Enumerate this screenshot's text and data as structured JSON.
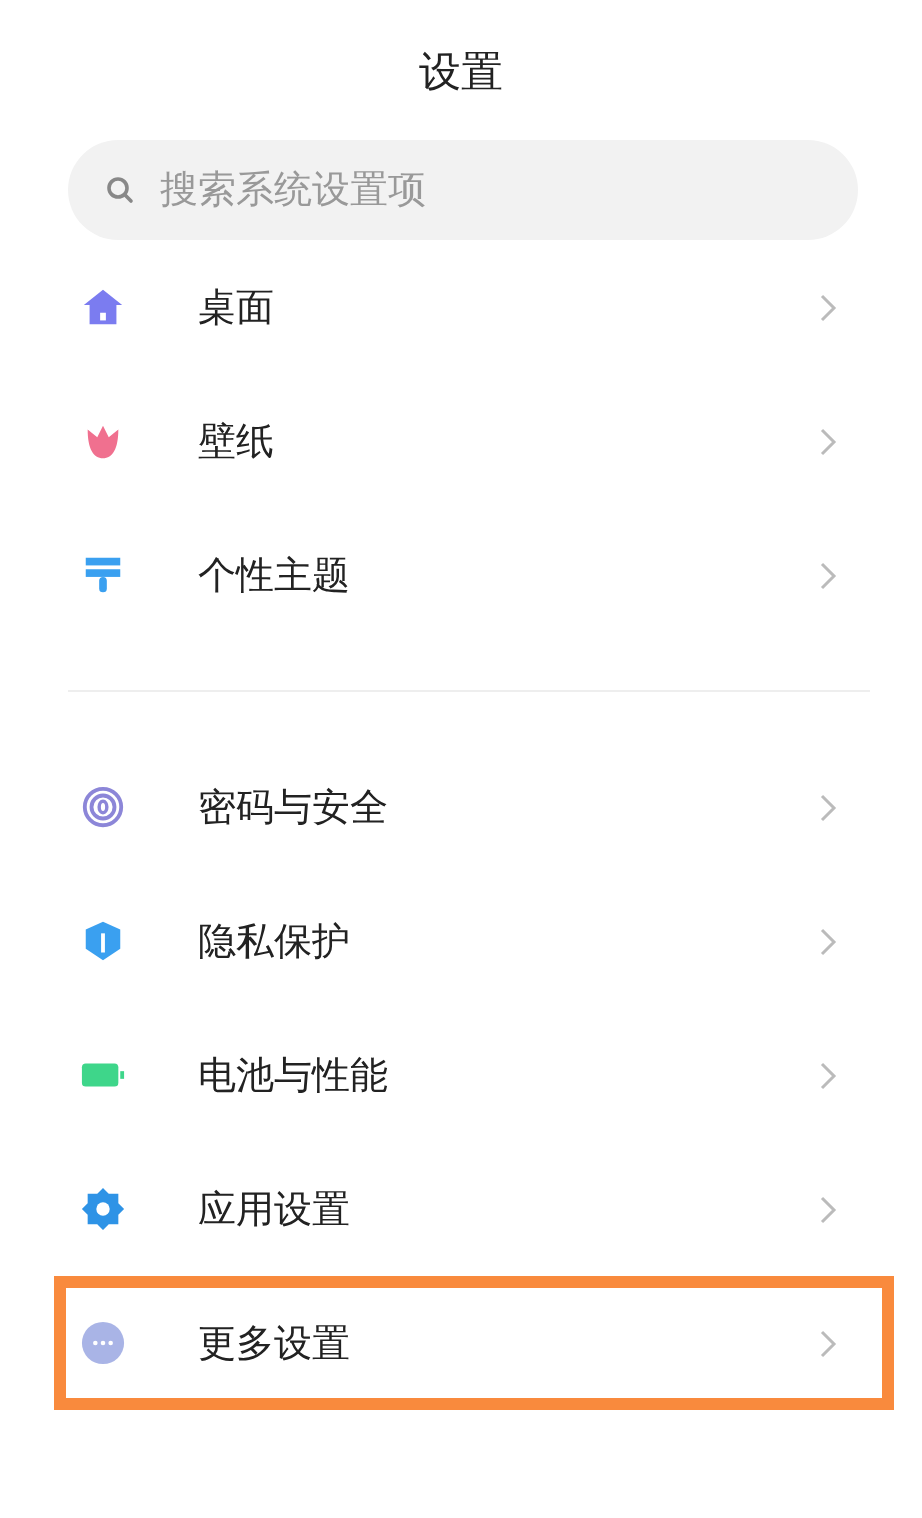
{
  "title": "设置",
  "search": {
    "placeholder": "搜索系统设置项"
  },
  "sections": [
    {
      "items": [
        {
          "label": "桌面",
          "kind": "home",
          "highlighted": false
        },
        {
          "label": "壁纸",
          "kind": "flower",
          "highlighted": false
        },
        {
          "label": "个性主题",
          "kind": "brush",
          "highlighted": false
        }
      ]
    },
    {
      "items": [
        {
          "label": "密码与安全",
          "kind": "fingerprint",
          "highlighted": false
        },
        {
          "label": "隐私保护",
          "kind": "shield",
          "highlighted": false
        },
        {
          "label": "电池与性能",
          "kind": "battery",
          "highlighted": false
        },
        {
          "label": "应用设置",
          "kind": "gear",
          "highlighted": false
        },
        {
          "label": "更多设置",
          "kind": "more",
          "highlighted": true
        }
      ]
    }
  ]
}
